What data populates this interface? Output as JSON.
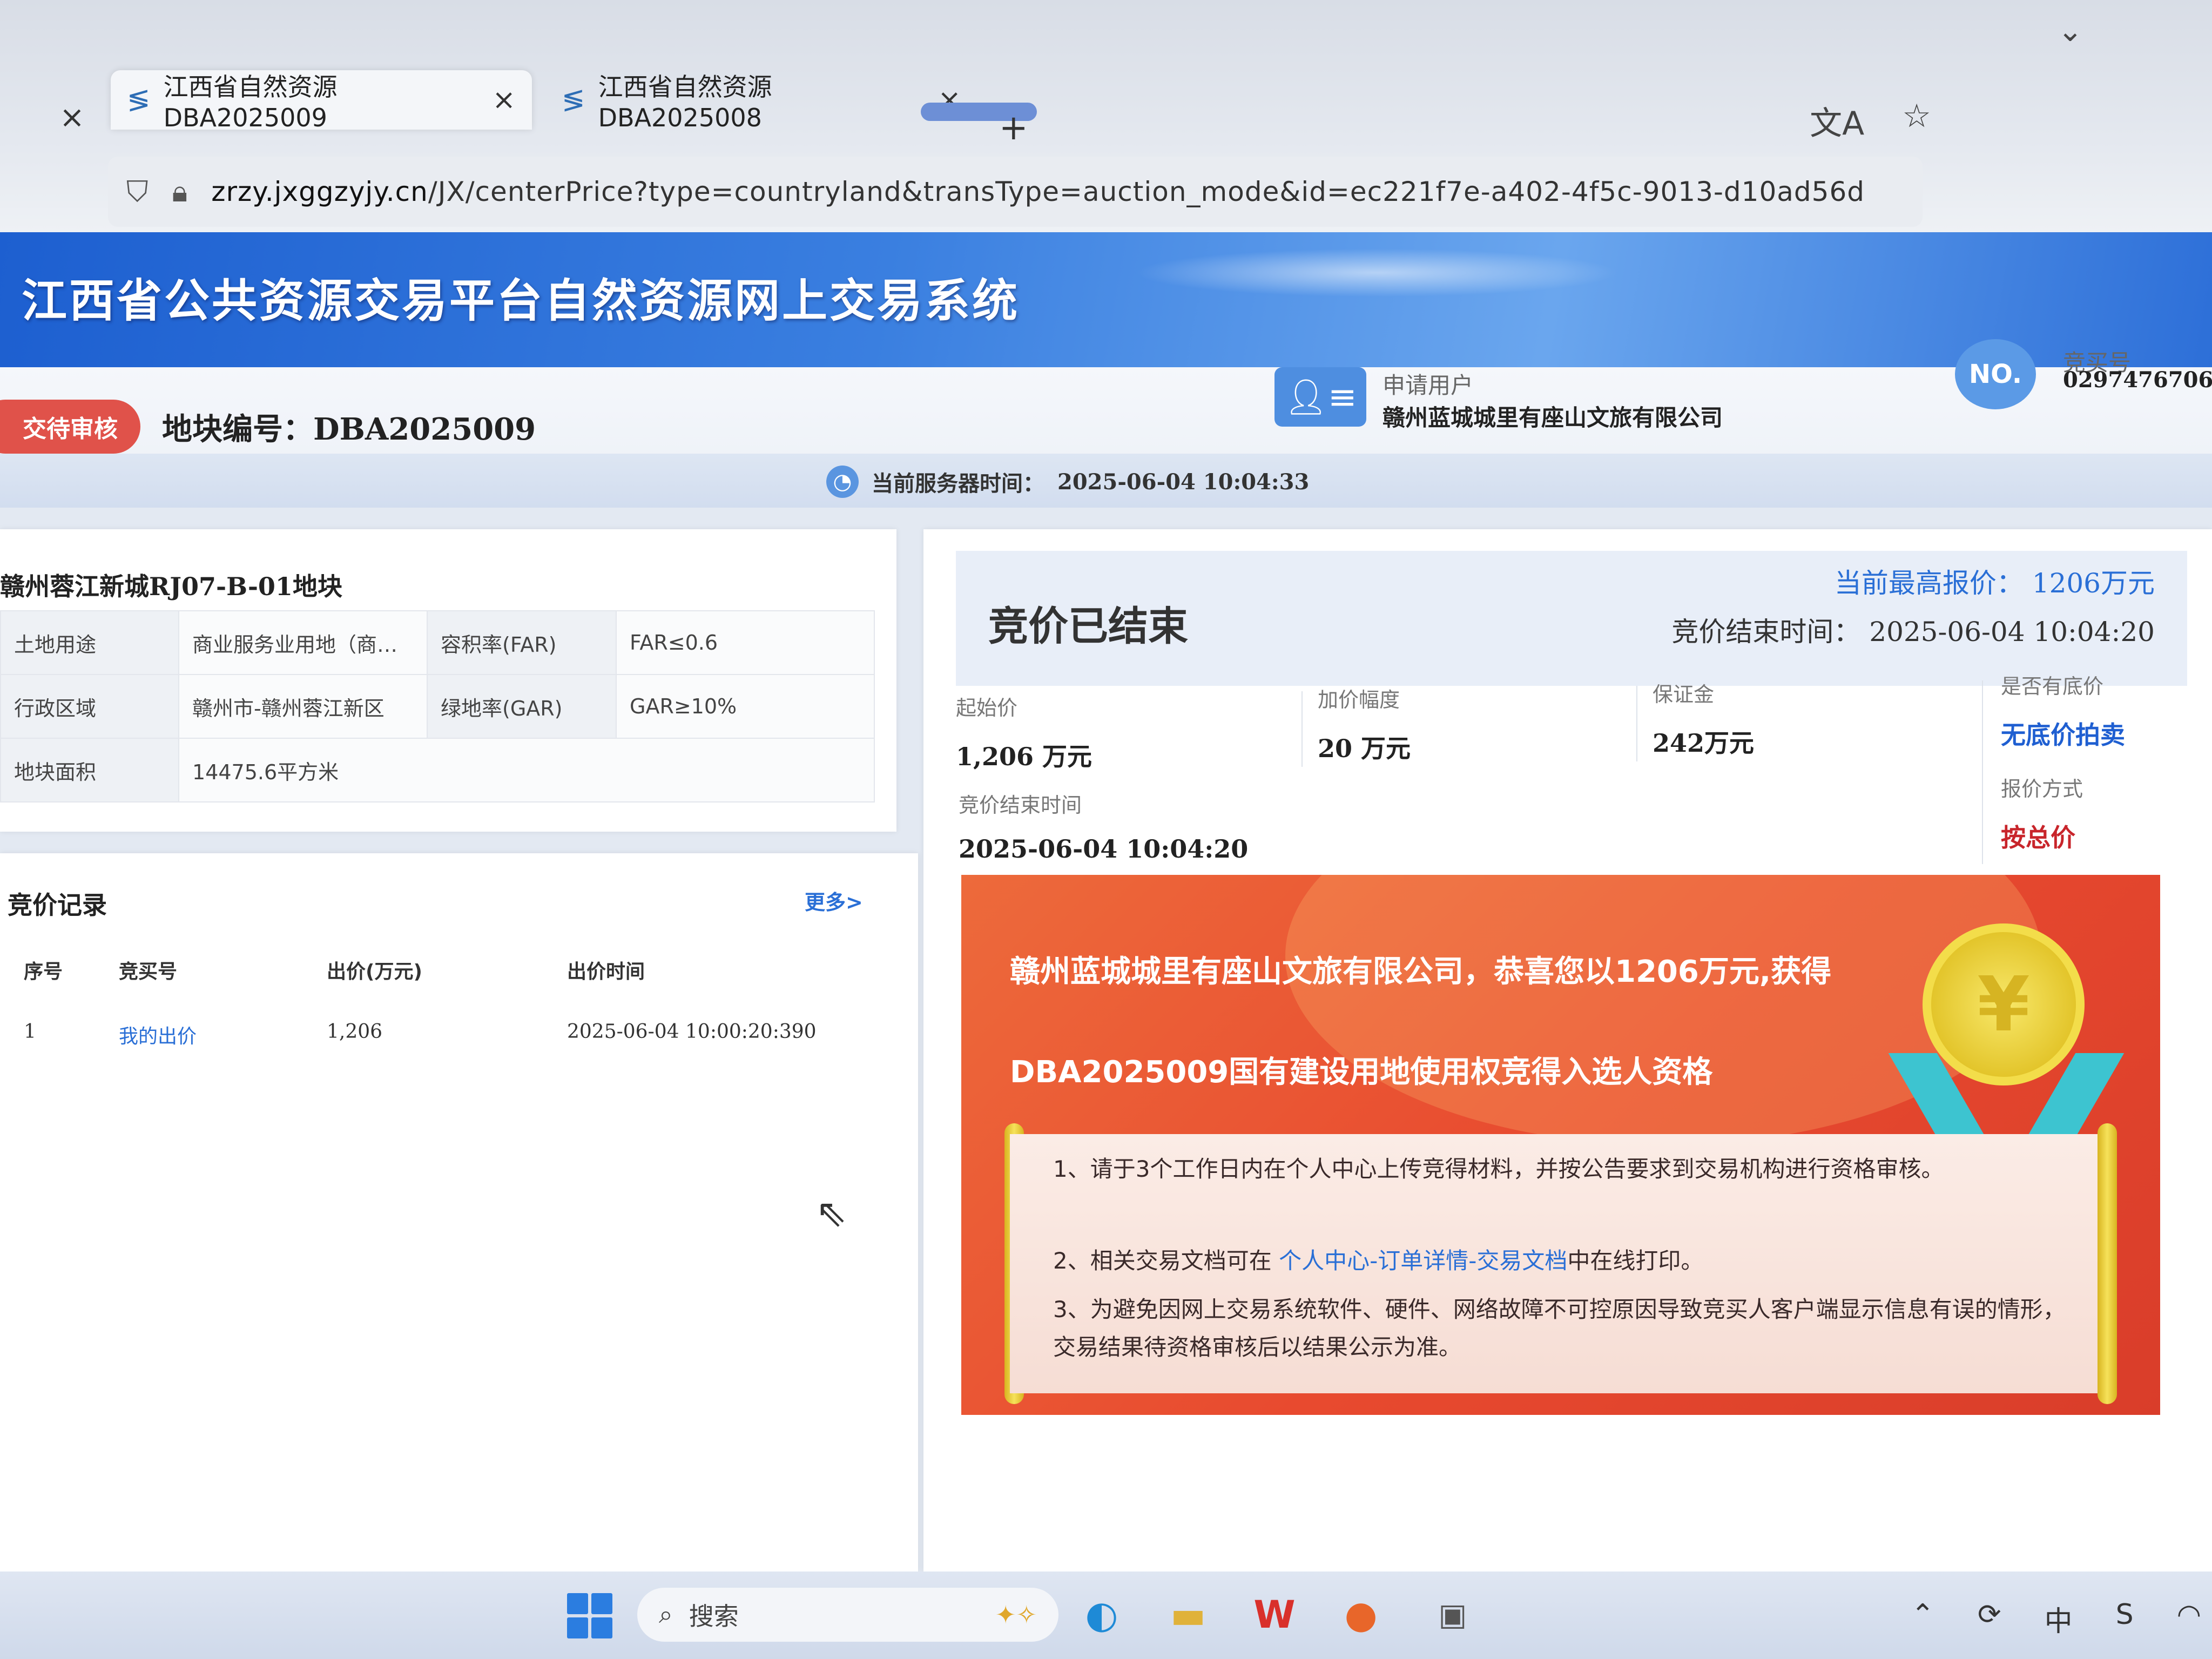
{
  "browser": {
    "tabs": [
      {
        "title": "江西省自然资源DBA2025009",
        "active": true
      },
      {
        "title": "江西省自然资源DBA2025008",
        "active": false
      }
    ],
    "url_host": "zrzy.jxggzyjy.cn",
    "url_path": "/JX/centerPrice?type=countryland&transType=auction_mode&id=ec221f7e-a402-4f5c-9013-d10ad56d"
  },
  "header": {
    "system_title": "江西省公共资源交易平台自然资源网上交易系统",
    "status_badge": "交待审核",
    "plot_label": "地块编号：",
    "plot_no": "DBA2025009",
    "user_label": "申请用户",
    "user_name": "赣州蓝城城里有座山文旅有限公司",
    "no_badge": "NO.",
    "bidder_label": "竞买号",
    "bidder_no": "0297476706",
    "server_time_label": "当前服务器时间：",
    "server_time": "2025-06-04 10:04:33"
  },
  "land": {
    "title": "赣州蓉江新城RJ07-B-01地块",
    "rows": [
      {
        "k1": "土地用途",
        "v1": "商业服务业用地（商…",
        "k2": "容积率(FAR)",
        "v2": "FAR≤0.6"
      },
      {
        "k1": "行政区域",
        "v1": "赣州市-赣州蓉江新区",
        "k2": "绿地率(GAR)",
        "v2": "GAR≥10%"
      },
      {
        "k1": "地块面积",
        "v1": "14475.6平方米"
      }
    ]
  },
  "records": {
    "title": "竞价记录",
    "more": "更多>",
    "headers": [
      "序号",
      "竞买号",
      "出价(万元)",
      "出价时间"
    ],
    "rows": [
      {
        "seq": "1",
        "bidder": "我的出价",
        "price": "1,206",
        "time": "2025-06-04 10:00:20:390"
      }
    ]
  },
  "result": {
    "state": "竞价已结束",
    "top_price": "当前最高报价：  1206万元",
    "end_time_head": "竞价结束时间：  2025-06-04 10:04:20",
    "start_price_label": "起始价",
    "start_price": "1,206 万元",
    "increment_label": "加价幅度",
    "increment": "20 万元",
    "deposit_label": "保证金",
    "deposit": "242万元",
    "reserve_label": "是否有底价",
    "reserve": "无底价拍卖",
    "end_time_label": "竞价结束时间",
    "end_time": "2025-06-04 10:04:20",
    "quote_mode_label": "报价方式",
    "quote_mode": "按总价",
    "congrats_line1": "赣州蓝城城里有座山文旅有限公司，恭喜您以1206万元,获得",
    "congrats_line2": "DBA2025009国有建设用地使用权竞得入选人资格",
    "medal_symbol": "¥",
    "note1": "1、请于3个工作日内在个人中心上传竞得材料，并按公告要求到交易机构进行资格审核。",
    "note2_prefix": "2、相关交易文档可在 ",
    "note2_link": "个人中心-订单详情-交易文档",
    "note2_suffix": "中在线打印。",
    "note3": "3、为避免因网上交易系统软件、硬件、网络故障不可控原因导致竞买人客户端显示信息有误的情形，交易结果待资格审核后以结果公示为准。"
  },
  "taskbar": {
    "search_placeholder": "搜索"
  },
  "colors": {
    "accent_blue": "#2a6fd6",
    "status_red": "#e0524a",
    "banner_blue": "#1d5fd0",
    "congrats_orange": "#e84a2f",
    "quote_red": "#c8252b"
  }
}
